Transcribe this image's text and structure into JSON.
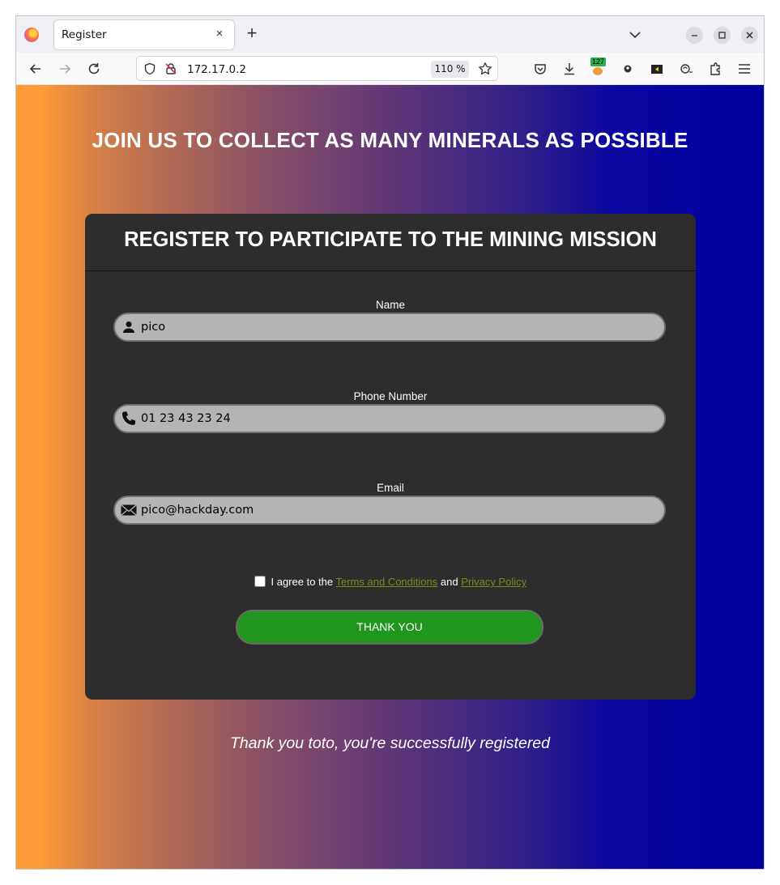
{
  "browser": {
    "tab_title": "Register",
    "tab_close_glyph": "×",
    "new_tab_glyph": "+",
    "url": "172.17.0.2",
    "zoom": "110 %",
    "extension_badge": "127",
    "icons": [
      "firefox-logo-icon",
      "back-icon",
      "forward-icon",
      "reload-icon",
      "shield-icon",
      "insecure-lock-icon",
      "bookmark-star-icon",
      "pocket-icon",
      "download-icon",
      "extension-icon",
      "menu-icon"
    ]
  },
  "page": {
    "headline": "JOIN US TO COLLECT AS MANY MINERALS AS POSSIBLE",
    "form": {
      "title": "REGISTER TO PARTICIPATE TO THE MINING MISSION",
      "name_label": "Name",
      "name_value": "pico",
      "phone_label": "Phone Number",
      "phone_value": "01 23 43 23 24",
      "email_label": "Email",
      "email_value": "pico@hackday.com",
      "agree_prefix": "I agree to the",
      "terms_link": "Terms and Conditions",
      "agree_and": "and",
      "privacy_link": "Privacy Policy",
      "submit_label": "THANK YOU"
    },
    "success_message": "Thank you toto, you're successfully registered"
  },
  "colors": {
    "gradient_start": "#ff9b38",
    "gradient_end": "#00009f",
    "card_bg": "#2d2d2d",
    "button_green": "#21961f",
    "link_olive": "#7d8a1a"
  }
}
